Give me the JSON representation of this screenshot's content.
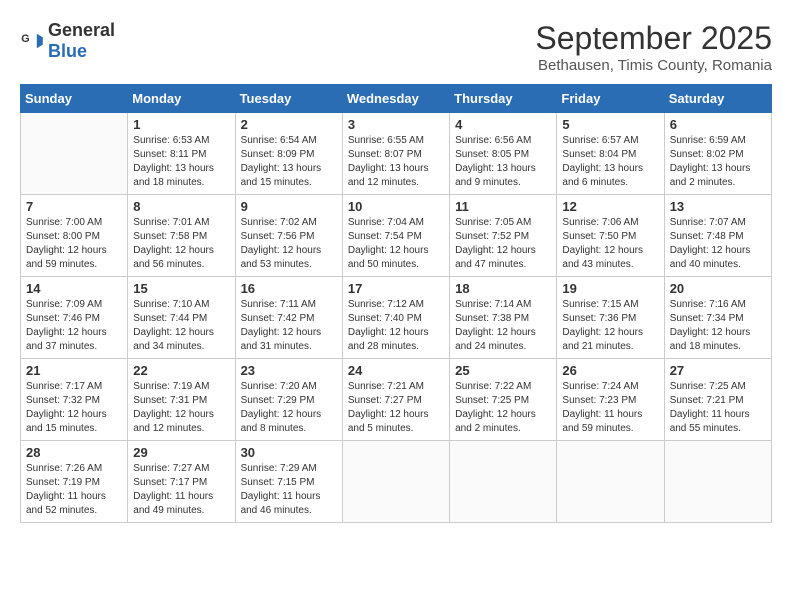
{
  "header": {
    "logo_general": "General",
    "logo_blue": "Blue",
    "month": "September 2025",
    "location": "Bethausen, Timis County, Romania"
  },
  "weekdays": [
    "Sunday",
    "Monday",
    "Tuesday",
    "Wednesday",
    "Thursday",
    "Friday",
    "Saturday"
  ],
  "weeks": [
    [
      {
        "day": "",
        "info": ""
      },
      {
        "day": "1",
        "info": "Sunrise: 6:53 AM\nSunset: 8:11 PM\nDaylight: 13 hours\nand 18 minutes."
      },
      {
        "day": "2",
        "info": "Sunrise: 6:54 AM\nSunset: 8:09 PM\nDaylight: 13 hours\nand 15 minutes."
      },
      {
        "day": "3",
        "info": "Sunrise: 6:55 AM\nSunset: 8:07 PM\nDaylight: 13 hours\nand 12 minutes."
      },
      {
        "day": "4",
        "info": "Sunrise: 6:56 AM\nSunset: 8:05 PM\nDaylight: 13 hours\nand 9 minutes."
      },
      {
        "day": "5",
        "info": "Sunrise: 6:57 AM\nSunset: 8:04 PM\nDaylight: 13 hours\nand 6 minutes."
      },
      {
        "day": "6",
        "info": "Sunrise: 6:59 AM\nSunset: 8:02 PM\nDaylight: 13 hours\nand 2 minutes."
      }
    ],
    [
      {
        "day": "7",
        "info": "Sunrise: 7:00 AM\nSunset: 8:00 PM\nDaylight: 12 hours\nand 59 minutes."
      },
      {
        "day": "8",
        "info": "Sunrise: 7:01 AM\nSunset: 7:58 PM\nDaylight: 12 hours\nand 56 minutes."
      },
      {
        "day": "9",
        "info": "Sunrise: 7:02 AM\nSunset: 7:56 PM\nDaylight: 12 hours\nand 53 minutes."
      },
      {
        "day": "10",
        "info": "Sunrise: 7:04 AM\nSunset: 7:54 PM\nDaylight: 12 hours\nand 50 minutes."
      },
      {
        "day": "11",
        "info": "Sunrise: 7:05 AM\nSunset: 7:52 PM\nDaylight: 12 hours\nand 47 minutes."
      },
      {
        "day": "12",
        "info": "Sunrise: 7:06 AM\nSunset: 7:50 PM\nDaylight: 12 hours\nand 43 minutes."
      },
      {
        "day": "13",
        "info": "Sunrise: 7:07 AM\nSunset: 7:48 PM\nDaylight: 12 hours\nand 40 minutes."
      }
    ],
    [
      {
        "day": "14",
        "info": "Sunrise: 7:09 AM\nSunset: 7:46 PM\nDaylight: 12 hours\nand 37 minutes."
      },
      {
        "day": "15",
        "info": "Sunrise: 7:10 AM\nSunset: 7:44 PM\nDaylight: 12 hours\nand 34 minutes."
      },
      {
        "day": "16",
        "info": "Sunrise: 7:11 AM\nSunset: 7:42 PM\nDaylight: 12 hours\nand 31 minutes."
      },
      {
        "day": "17",
        "info": "Sunrise: 7:12 AM\nSunset: 7:40 PM\nDaylight: 12 hours\nand 28 minutes."
      },
      {
        "day": "18",
        "info": "Sunrise: 7:14 AM\nSunset: 7:38 PM\nDaylight: 12 hours\nand 24 minutes."
      },
      {
        "day": "19",
        "info": "Sunrise: 7:15 AM\nSunset: 7:36 PM\nDaylight: 12 hours\nand 21 minutes."
      },
      {
        "day": "20",
        "info": "Sunrise: 7:16 AM\nSunset: 7:34 PM\nDaylight: 12 hours\nand 18 minutes."
      }
    ],
    [
      {
        "day": "21",
        "info": "Sunrise: 7:17 AM\nSunset: 7:32 PM\nDaylight: 12 hours\nand 15 minutes."
      },
      {
        "day": "22",
        "info": "Sunrise: 7:19 AM\nSunset: 7:31 PM\nDaylight: 12 hours\nand 12 minutes."
      },
      {
        "day": "23",
        "info": "Sunrise: 7:20 AM\nSunset: 7:29 PM\nDaylight: 12 hours\nand 8 minutes."
      },
      {
        "day": "24",
        "info": "Sunrise: 7:21 AM\nSunset: 7:27 PM\nDaylight: 12 hours\nand 5 minutes."
      },
      {
        "day": "25",
        "info": "Sunrise: 7:22 AM\nSunset: 7:25 PM\nDaylight: 12 hours\nand 2 minutes."
      },
      {
        "day": "26",
        "info": "Sunrise: 7:24 AM\nSunset: 7:23 PM\nDaylight: 11 hours\nand 59 minutes."
      },
      {
        "day": "27",
        "info": "Sunrise: 7:25 AM\nSunset: 7:21 PM\nDaylight: 11 hours\nand 55 minutes."
      }
    ],
    [
      {
        "day": "28",
        "info": "Sunrise: 7:26 AM\nSunset: 7:19 PM\nDaylight: 11 hours\nand 52 minutes."
      },
      {
        "day": "29",
        "info": "Sunrise: 7:27 AM\nSunset: 7:17 PM\nDaylight: 11 hours\nand 49 minutes."
      },
      {
        "day": "30",
        "info": "Sunrise: 7:29 AM\nSunset: 7:15 PM\nDaylight: 11 hours\nand 46 minutes."
      },
      {
        "day": "",
        "info": ""
      },
      {
        "day": "",
        "info": ""
      },
      {
        "day": "",
        "info": ""
      },
      {
        "day": "",
        "info": ""
      }
    ]
  ]
}
